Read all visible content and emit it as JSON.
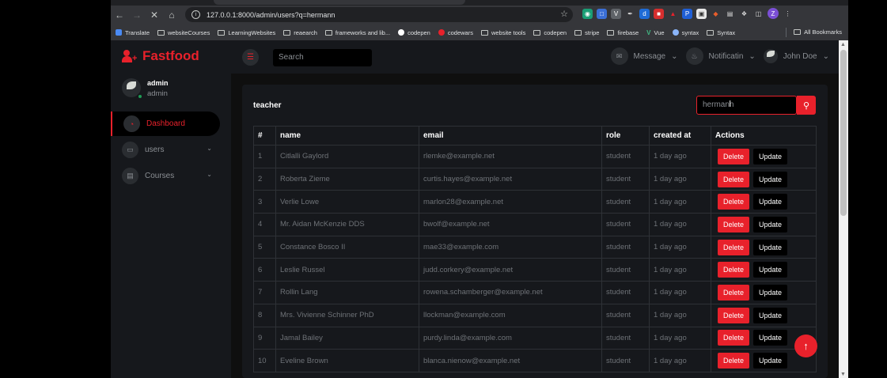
{
  "browser": {
    "url": "127.0.0.1:8000/admin/users?q=hermann",
    "profile_initial": "Z",
    "bookmarks": [
      "Translate",
      "websiteCourses",
      "LearningWebsites",
      "reaearch",
      "frameworks and lib...",
      "codepen",
      "codewars",
      "website tools",
      "codepen",
      "stripe",
      "firebase",
      "Vue",
      "syntax",
      "Syntax"
    ],
    "all_bookmarks": "All Bookmarks"
  },
  "app": {
    "brand": "Fastfood",
    "user": {
      "name": "admin",
      "role": "admin"
    },
    "nav": [
      {
        "label": "Dashboard",
        "icon": "dashboard-icon"
      },
      {
        "label": "users",
        "icon": "laptop-icon"
      },
      {
        "label": "Courses",
        "icon": "file-icon"
      }
    ],
    "top_search_placeholder": "Search",
    "message_label": "Message",
    "notification_label": "Notificatin",
    "profile_name": "John Doe"
  },
  "card": {
    "title": "teacher",
    "search_value": "hermann",
    "columns": [
      "#",
      "name",
      "email",
      "role",
      "created at",
      "Actions"
    ],
    "delete_label": "Delete",
    "update_label": "Update",
    "rows": [
      {
        "id": "1",
        "name": "Citlalli Gaylord",
        "email": "rlemke@example.net",
        "role": "student",
        "created": "1 day ago"
      },
      {
        "id": "2",
        "name": "Roberta Zieme",
        "email": "curtis.hayes@example.net",
        "role": "student",
        "created": "1 day ago"
      },
      {
        "id": "3",
        "name": "Verlie Lowe",
        "email": "marlon28@example.net",
        "role": "student",
        "created": "1 day ago"
      },
      {
        "id": "4",
        "name": "Mr. Aidan McKenzie DDS",
        "email": "bwolf@example.net",
        "role": "student",
        "created": "1 day ago"
      },
      {
        "id": "5",
        "name": "Constance Bosco II",
        "email": "mae33@example.com",
        "role": "student",
        "created": "1 day ago"
      },
      {
        "id": "6",
        "name": "Leslie Russel",
        "email": "judd.corkery@example.net",
        "role": "student",
        "created": "1 day ago"
      },
      {
        "id": "7",
        "name": "Rollin Lang",
        "email": "rowena.schamberger@example.net",
        "role": "student",
        "created": "1 day ago"
      },
      {
        "id": "8",
        "name": "Mrs. Vivienne Schinner PhD",
        "email": "llockman@example.com",
        "role": "student",
        "created": "1 day ago"
      },
      {
        "id": "9",
        "name": "Jamal Bailey",
        "email": "purdy.linda@example.com",
        "role": "student",
        "created": "1 day ago"
      },
      {
        "id": "10",
        "name": "Eveline Brown",
        "email": "blanca.nienow@example.net",
        "role": "student",
        "created": "1 day ago"
      }
    ]
  },
  "colors": {
    "accent": "#e8212b",
    "panel": "#16181c",
    "page": "#0f0f0f"
  }
}
